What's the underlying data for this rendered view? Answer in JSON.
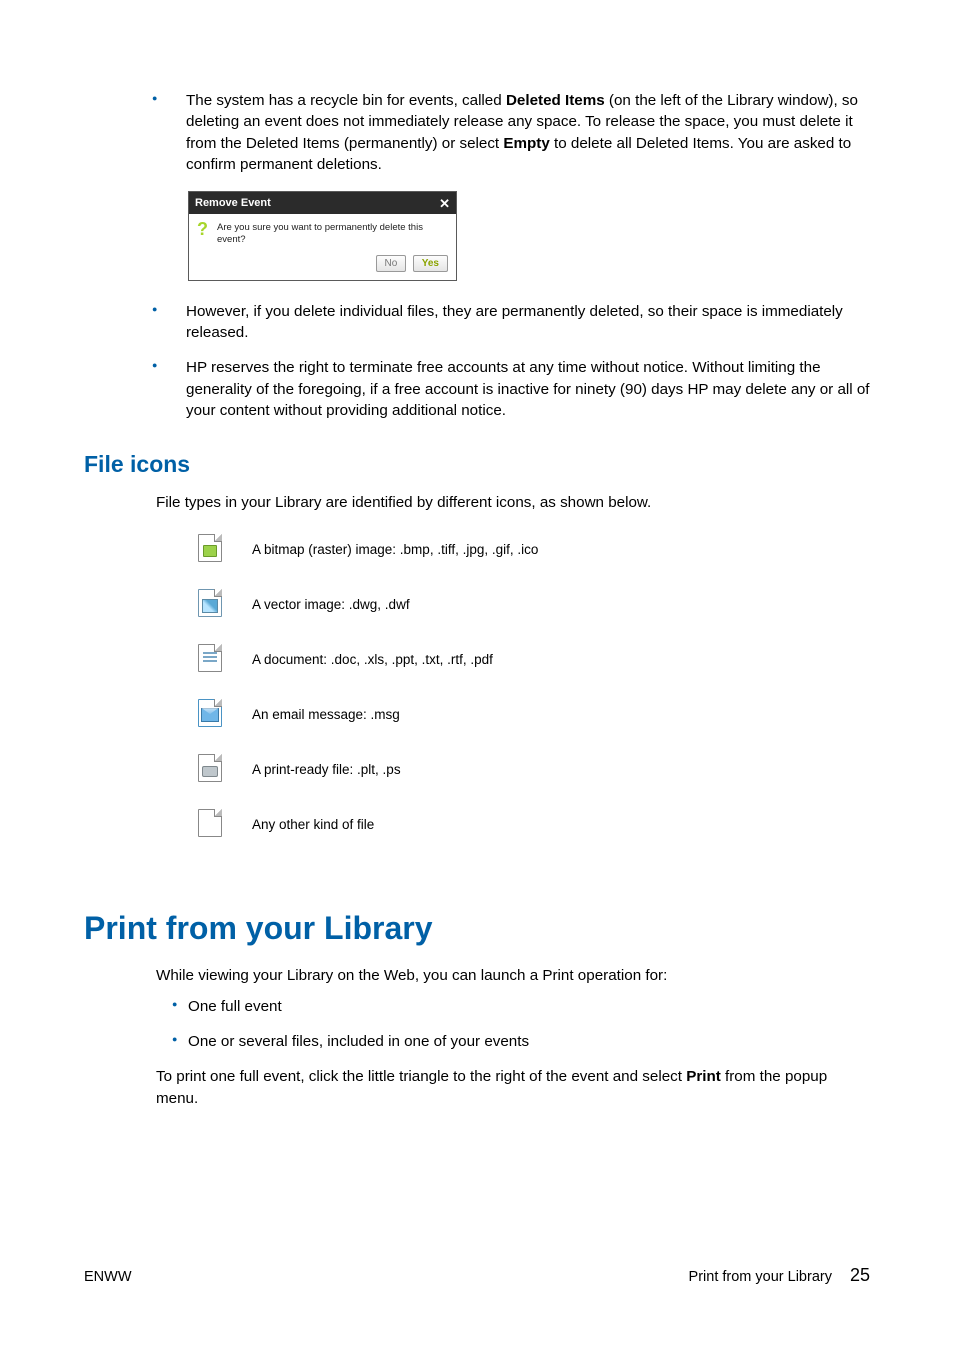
{
  "bullets_top": [
    {
      "pre": "The system has a recycle bin for events, called ",
      "b1": "Deleted Items",
      "mid": " (on the left of the Library window), so deleting an event does not immediately release any space. To release the space, you must delete it from the Deleted Items (permanently) or select ",
      "b2": "Empty",
      "post": " to delete all Deleted Items. You are asked to confirm permanent deletions."
    }
  ],
  "dialog": {
    "title": "Remove Event",
    "close": "✕",
    "qmark": "?",
    "message": "Are you sure you want to permanently delete this event?",
    "no": "No",
    "yes": "Yes"
  },
  "bullets_mid": [
    "However, if you delete individual files, they are permanently deleted, so their space is immediately released.",
    "HP reserves the right to terminate free accounts at any time without notice. Without limiting the generality of the foregoing, if a free account is inactive for ninety (90) days HP may delete any or all of your content without providing additional notice."
  ],
  "section_file_icons": "File icons",
  "file_icons_intro": "File types in your Library are identified by different icons, as shown below.",
  "icon_rows": [
    "A bitmap (raster) image: .bmp, .tiff, .jpg, .gif, .ico",
    "A vector image: .dwg, .dwf",
    "A document: .doc, .xls, .ppt, .txt, .rtf, .pdf",
    "An email message: .msg",
    "A print-ready file: .plt, .ps",
    "Any other kind of file"
  ],
  "title_print": "Print from your Library",
  "print_intro": "While viewing your Library on the Web, you can launch a Print operation for:",
  "print_bullets": [
    "One full event",
    "One or several files, included in one of your events"
  ],
  "print_para": {
    "pre": "To print one full event, click the little triangle to the right of the event and select ",
    "b": "Print",
    "post": " from the popup menu."
  },
  "footer": {
    "left": "ENWW",
    "right_label": "Print from your Library",
    "page": "25"
  }
}
